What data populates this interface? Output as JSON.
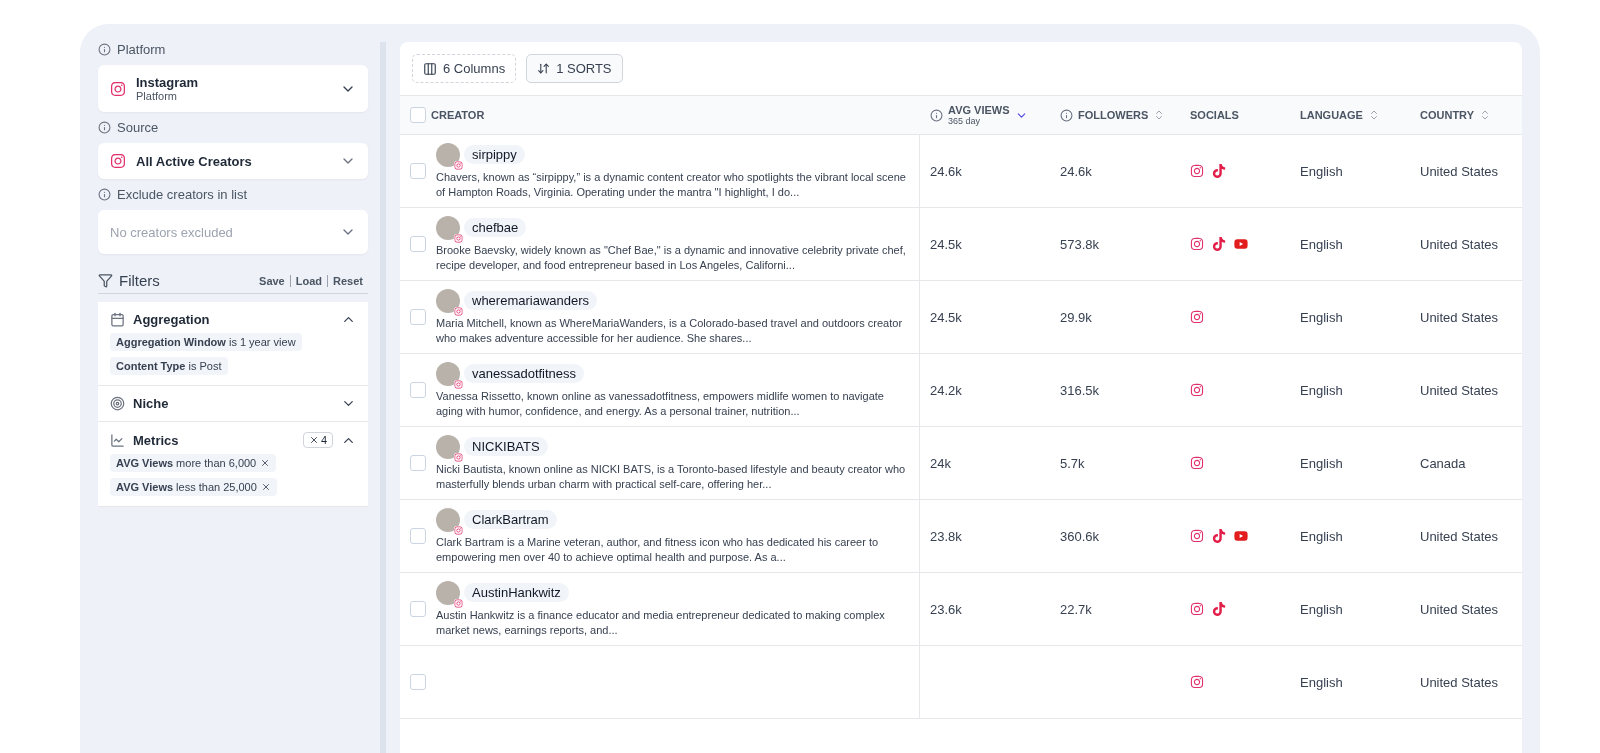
{
  "sidebar": {
    "platform": {
      "label": "Platform",
      "value": "Instagram",
      "sub": "Platform"
    },
    "source": {
      "label": "Source",
      "value": "All Active Creators"
    },
    "exclude": {
      "label": "Exclude creators in list",
      "placeholder": "No creators excluded"
    },
    "filters": {
      "title": "Filters",
      "actions": [
        "Save",
        "Load",
        "Reset"
      ],
      "groups": [
        {
          "kind": "aggregation",
          "title": "Aggregation",
          "expanded": true,
          "chips": [
            {
              "text": "**Aggregation Window** is 1 year view",
              "removable": false
            },
            {
              "text": "**Content Type** is Post",
              "removable": false
            }
          ]
        },
        {
          "kind": "niche",
          "title": "Niche",
          "expanded": false
        },
        {
          "kind": "metrics",
          "title": "Metrics",
          "expanded": true,
          "count": "4",
          "chips": [
            {
              "text": "**AVG Views** more than 6,000",
              "removable": true
            },
            {
              "text": "**AVG Views** less than 25,000",
              "removable": true
            }
          ]
        }
      ]
    }
  },
  "toolbar": {
    "columns": "6 Columns",
    "sorts": "1 SORTS"
  },
  "table": {
    "columns": [
      {
        "label": "CREATOR",
        "checked": false
      },
      {
        "label": "AVG VIEWS",
        "sub": "365 day",
        "info": true,
        "sortable": true,
        "sorted": true
      },
      {
        "label": "FOLLOWERS",
        "info": true,
        "sortable": true,
        "sorted": false
      },
      {
        "label": "SOCIALS"
      },
      {
        "label": "LANGUAGE",
        "sortable": true,
        "sorted": false
      },
      {
        "label": "COUNTRY",
        "sortable": true,
        "sorted": false
      }
    ],
    "rows": [
      {
        "handle": "sirpippy",
        "checked": false,
        "bio": "Chavers, known as “sirpippy,” is a dynamic content creator who spotlights the vibrant local scene of Hampton Roads, Virginia. Operating under the mantra \"I highlight, I do...",
        "avg_views": "24.6k",
        "followers": "24.6k",
        "socials": [
          {
            "kind": "instagram"
          },
          {
            "kind": "tiktok"
          }
        ],
        "language": "English",
        "country": "United States"
      },
      {
        "handle": "chefbae",
        "checked": false,
        "bio": "Brooke Baevsky, widely known as \"Chef Bae,\" is a dynamic and innovative celebrity private chef, recipe developer, and food entrepreneur based in Los Angeles, Californi...",
        "avg_views": "24.5k",
        "followers": "573.8k",
        "socials": [
          {
            "kind": "instagram"
          },
          {
            "kind": "tiktok"
          },
          {
            "kind": "youtube"
          }
        ],
        "language": "English",
        "country": "United States"
      },
      {
        "handle": "wheremariawanders",
        "checked": false,
        "bio": "Maria Mitchell, known as WhereMariaWanders, is a Colorado-based travel and outdoors creator who makes adventure accessible for her audience. She shares...",
        "avg_views": "24.5k",
        "followers": "29.9k",
        "socials": [
          {
            "kind": "instagram"
          }
        ],
        "language": "English",
        "country": "United States"
      },
      {
        "handle": "vanessadotfitness",
        "checked": false,
        "bio": "Vanessa Rissetto, known online as vanessadotfitness, empowers midlife women to navigate aging with humor, confidence, and energy. As a personal trainer, nutrition...",
        "avg_views": "24.2k",
        "followers": "316.5k",
        "socials": [
          {
            "kind": "instagram"
          }
        ],
        "language": "English",
        "country": "United States"
      },
      {
        "handle": "NICKIBATS",
        "checked": false,
        "bio": "Nicki Bautista, known online as NICKI BATS, is a Toronto-based lifestyle and beauty creator who masterfully blends urban charm with practical self-care, offering her...",
        "avg_views": "24k",
        "followers": "5.7k",
        "socials": [
          {
            "kind": "instagram"
          }
        ],
        "language": "English",
        "country": "Canada"
      },
      {
        "handle": "ClarkBartram",
        "checked": false,
        "bio": "Clark Bartram is a Marine veteran, author, and fitness icon who has dedicated his career to empowering men over 40 to achieve optimal health and purpose. As a...",
        "avg_views": "23.8k",
        "followers": "360.6k",
        "socials": [
          {
            "kind": "instagram"
          },
          {
            "kind": "tiktok"
          },
          {
            "kind": "youtube"
          }
        ],
        "language": "English",
        "country": "United States"
      },
      {
        "handle": "AustinHankwitz",
        "checked": false,
        "bio": "Austin Hankwitz is a finance educator and media entrepreneur dedicated to making complex market news, earnings reports, and...",
        "avg_views": "23.6k",
        "followers": "22.7k",
        "socials": [
          {
            "kind": "instagram"
          },
          {
            "kind": "tiktok"
          }
        ],
        "language": "English",
        "country": "United States"
      },
      {
        "checked": false,
        "socials": [
          {
            "kind": "instagram"
          }
        ],
        "language": "English",
        "country": "United States"
      }
    ]
  }
}
